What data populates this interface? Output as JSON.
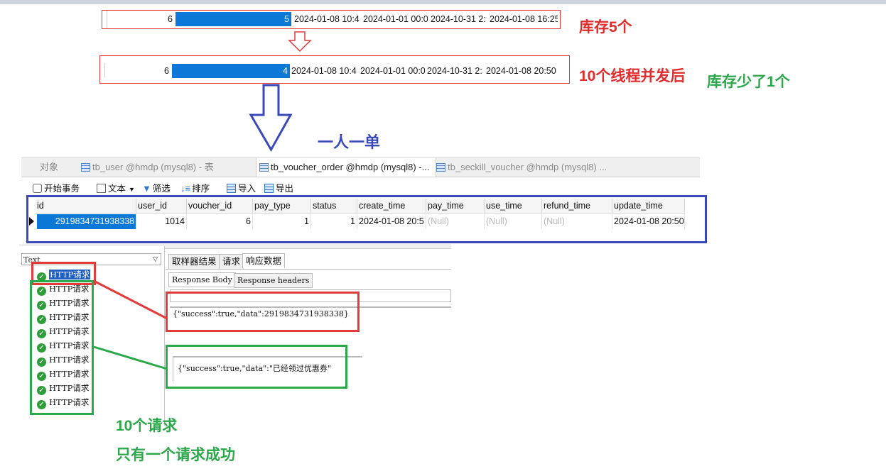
{
  "rows": {
    "before": [
      "6",
      "5",
      "2024-01-08 10:4",
      "2024-01-01 00:0",
      "2024-10-31 2:",
      "2024-01-08 16:25"
    ],
    "after": [
      "6",
      "4",
      "2024-01-08 10:4",
      "2024-01-01 00:0",
      "2024-10-31 2:",
      "2024-01-08 20:50"
    ]
  },
  "annotations": {
    "stock5": "库存5个",
    "threads": "10个线程并发后",
    "less1": "库存少了1个",
    "one_per_user": "一人一单",
    "ten_requests": "10个请求",
    "one_success": "只有一个请求成功"
  },
  "navicat": {
    "tabs": [
      "对象",
      "tb_user @hmdp (mysql8) - 表",
      "tb_voucher_order @hmdp (mysql8) -...",
      "tb_seckill_voucher @hmdp (mysql8) ..."
    ],
    "toolbar": [
      "开始事务",
      "文本",
      "筛选",
      "排序",
      "导入",
      "导出"
    ],
    "columns": [
      "id",
      "user_id",
      "voucher_id",
      "pay_type",
      "status",
      "create_time",
      "pay_time",
      "use_time",
      "refund_time",
      "update_time"
    ],
    "row": [
      "2919834731938338",
      "1014",
      "6",
      "1",
      "1",
      "2024-01-08 20:5",
      "(Null)",
      "(Null)",
      "(Null)",
      "2024-01-08 20:50"
    ]
  },
  "jmeter": {
    "renderer": "Text",
    "items": [
      "HTTP请求",
      "HTTP请求",
      "HTTP请求",
      "HTTP请求",
      "HTTP请求",
      "HTTP请求",
      "HTTP请求",
      "HTTP请求",
      "HTTP请求",
      "HTTP请求"
    ],
    "tabs": [
      "取样器结果",
      "请求",
      "响应数据"
    ],
    "subtabs": [
      "Response Body",
      "Response headers"
    ],
    "response_success": "{\"success\":true,\"data\":2919834731938338}",
    "response_fail": "{\"success\":true,\"data\":\"已经领过优惠券\""
  },
  "colors": {
    "red": "#e32b2b",
    "green": "#2aa84a",
    "blue": "#3a49b9",
    "selection": "#0b78d7"
  }
}
